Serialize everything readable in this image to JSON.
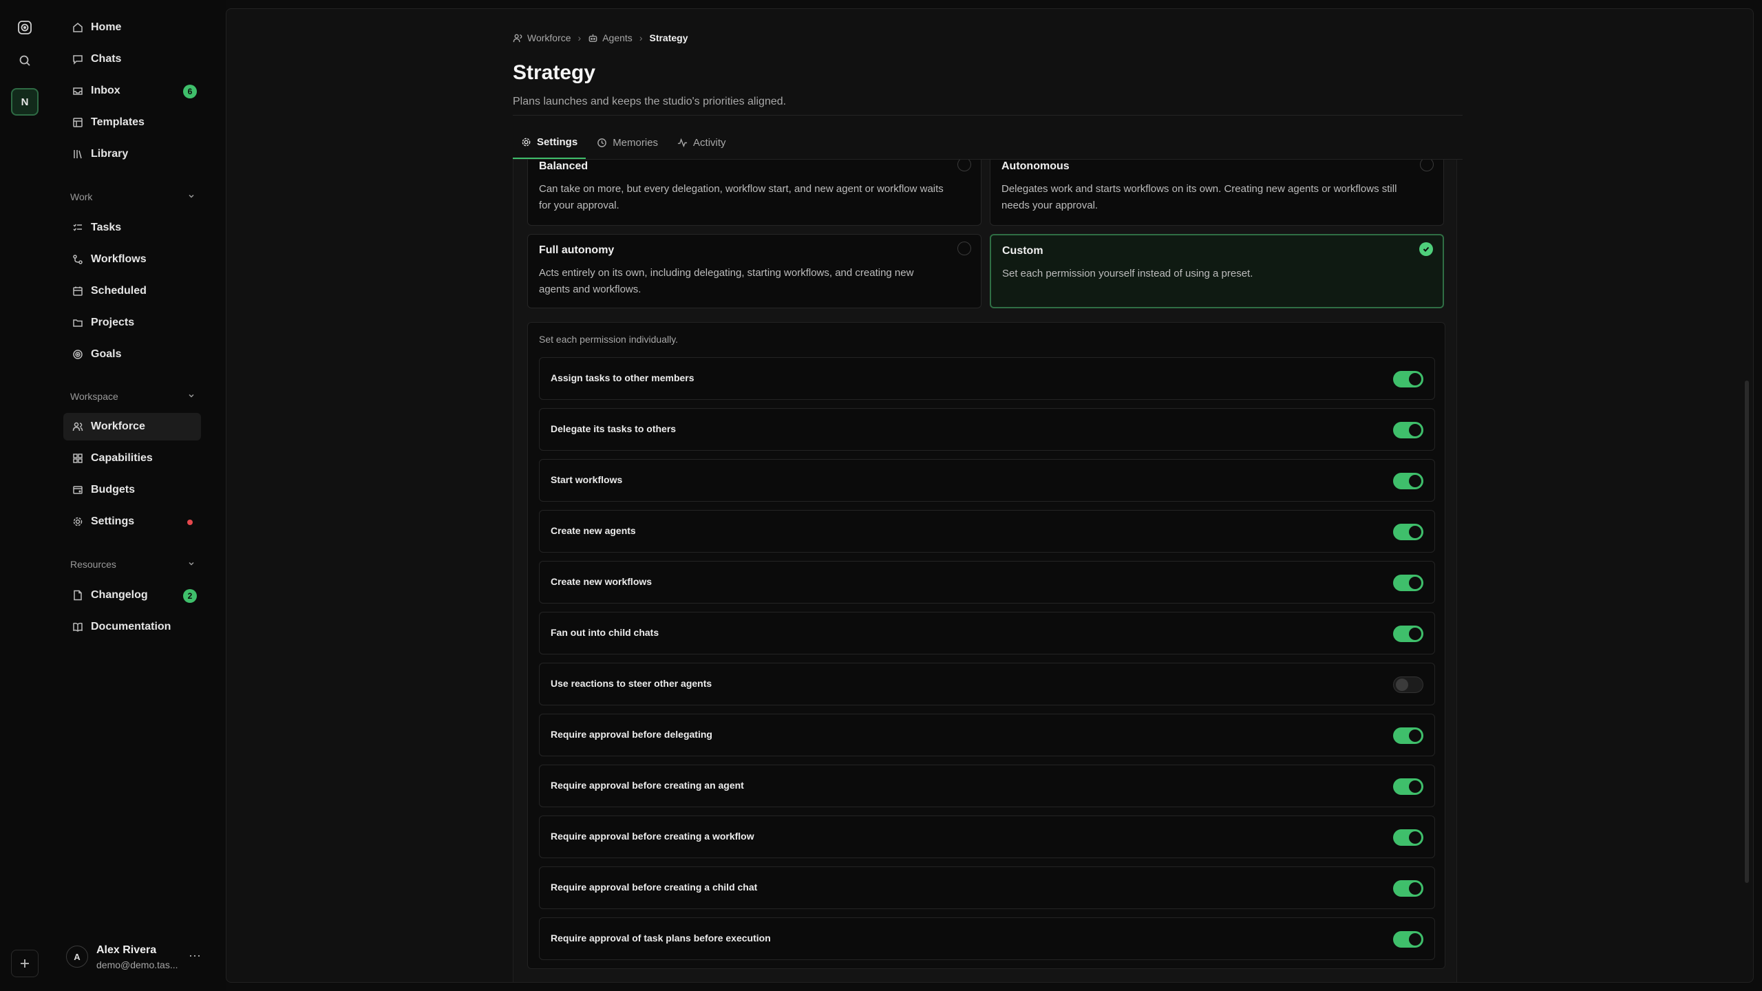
{
  "rail": {
    "workspace_initial": "N",
    "icons": [
      "logo-icon",
      "search-icon",
      "plus-icon"
    ]
  },
  "sidebar": {
    "top_items": [
      {
        "label": "Home",
        "icon": "home-icon"
      },
      {
        "label": "Chats",
        "icon": "chat-icon"
      },
      {
        "label": "Inbox",
        "icon": "inbox-icon",
        "badge": "6"
      },
      {
        "label": "Templates",
        "icon": "template-icon"
      },
      {
        "label": "Library",
        "icon": "library-icon"
      }
    ],
    "work": {
      "header": "Work",
      "items": [
        {
          "label": "Tasks",
          "icon": "tasks-icon"
        },
        {
          "label": "Workflows",
          "icon": "workflow-icon"
        },
        {
          "label": "Scheduled",
          "icon": "calendar-icon"
        },
        {
          "label": "Projects",
          "icon": "folder-icon"
        },
        {
          "label": "Goals",
          "icon": "target-icon"
        }
      ]
    },
    "workspace": {
      "header": "Workspace",
      "items": [
        {
          "label": "Workforce",
          "icon": "users-icon",
          "active": true
        },
        {
          "label": "Capabilities",
          "icon": "capabilities-icon"
        },
        {
          "label": "Budgets",
          "icon": "wallet-icon"
        },
        {
          "label": "Settings",
          "icon": "gear-icon",
          "alert": true
        }
      ]
    },
    "resources": {
      "header": "Resources",
      "items": [
        {
          "label": "Changelog",
          "icon": "file-icon",
          "badge": "2"
        },
        {
          "label": "Documentation",
          "icon": "book-icon"
        }
      ]
    },
    "user": {
      "initial": "A",
      "name": "Alex Rivera",
      "email": "demo@demo.tas..."
    }
  },
  "header": {
    "breadcrumb": [
      {
        "label": "Workforce",
        "icon": "users-icon"
      },
      {
        "label": "Agents",
        "icon": "bot-icon"
      },
      {
        "label": "Strategy"
      }
    ],
    "title": "Strategy",
    "subtitle": "Plans launches and keeps the studio's priorities aligned."
  },
  "tabs": [
    {
      "label": "Settings",
      "icon": "gear-icon",
      "active": true
    },
    {
      "label": "Memories",
      "icon": "clock-icon"
    },
    {
      "label": "Activity",
      "icon": "activity-icon"
    }
  ],
  "presets": [
    {
      "title": "Balanced",
      "desc": "Can take on more, but every delegation, workflow start, and new agent or workflow waits for your approval.",
      "selected": false
    },
    {
      "title": "Autonomous",
      "desc": "Delegates work and starts workflows on its own. Creating new agents or workflows still needs your approval.",
      "selected": false
    },
    {
      "title": "Full autonomy",
      "desc": "Acts entirely on its own, including delegating, starting workflows, and creating new agents and workflows.",
      "selected": false
    },
    {
      "title": "Custom",
      "desc": "Set each permission yourself instead of using a preset.",
      "selected": true
    }
  ],
  "custom": {
    "hint": "Set each permission individually.",
    "permissions": [
      {
        "label": "Assign tasks to other members",
        "on": true
      },
      {
        "label": "Delegate its tasks to others",
        "on": true
      },
      {
        "label": "Start workflows",
        "on": true
      },
      {
        "label": "Create new agents",
        "on": true
      },
      {
        "label": "Create new workflows",
        "on": true
      },
      {
        "label": "Fan out into child chats",
        "on": true
      },
      {
        "label": "Use reactions to steer other agents",
        "on": false
      },
      {
        "label": "Require approval before delegating",
        "on": true
      },
      {
        "label": "Require approval before creating an agent",
        "on": true
      },
      {
        "label": "Require approval before creating a workflow",
        "on": true
      },
      {
        "label": "Require approval before creating a child chat",
        "on": true
      },
      {
        "label": "Require approval of task plans before execution",
        "on": true
      }
    ]
  },
  "colors": {
    "accent": "#3fbf6b",
    "alert": "#e5484d",
    "background": "#0c0c0c"
  }
}
